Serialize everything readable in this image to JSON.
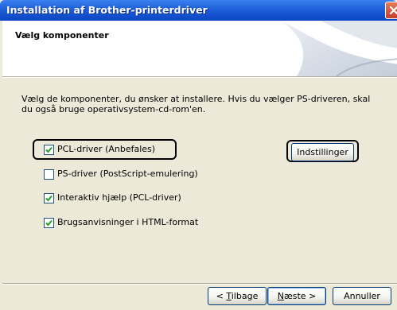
{
  "window": {
    "title": "Installation af Brother-printerdriver",
    "close_icon": "close-icon"
  },
  "header": {
    "heading": "Vælg komponenter"
  },
  "main": {
    "description": "Vælg de komponenter, du ønsker at installere. Hvis du vælger PS-driveren, skal du også bruge operativsystem-cd-rom'en.",
    "options": [
      {
        "label": "PCL-driver (Anbefales)",
        "checked": true
      },
      {
        "label": "PS-driver (PostScript-emulering)",
        "checked": false
      },
      {
        "label": "Interaktiv hjælp (PCL-driver)",
        "checked": true
      },
      {
        "label": "Brugsanvisninger i HTML-format",
        "checked": true
      }
    ],
    "settings_button": "Indstillinger"
  },
  "footer": {
    "back_prefix": "< ",
    "back_key": "T",
    "back_rest": "ilbage",
    "next_key": "N",
    "next_rest": "æste >",
    "cancel": "Annuller"
  },
  "colors": {
    "titlebar": "#0b45c4",
    "dialog_bg": "#ece9d8",
    "checkmark": "#21a121"
  }
}
